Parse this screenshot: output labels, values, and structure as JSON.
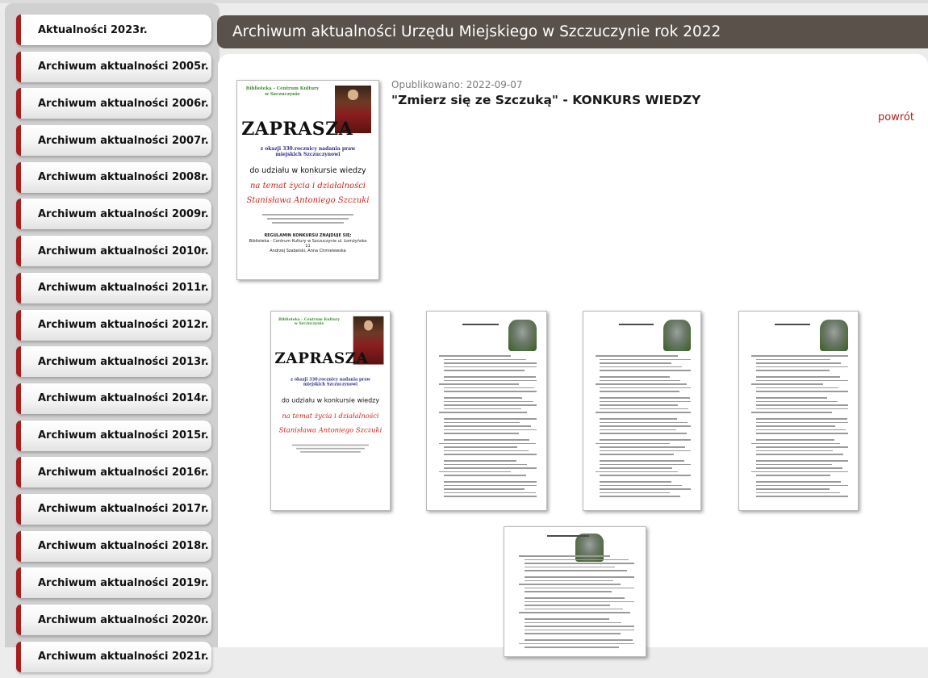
{
  "sidebar": {
    "items": [
      {
        "label": "Aktualności 2023r."
      },
      {
        "label": "Archiwum aktualności 2005r."
      },
      {
        "label": "Archiwum aktualności 2006r."
      },
      {
        "label": "Archiwum aktualności 2007r."
      },
      {
        "label": "Archiwum aktualności 2008r."
      },
      {
        "label": "Archiwum aktualności 2009r."
      },
      {
        "label": "Archiwum aktualności 2010r."
      },
      {
        "label": "Archiwum aktualności 2011r."
      },
      {
        "label": "Archiwum aktualności 2012r."
      },
      {
        "label": "Archiwum aktualności 2013r."
      },
      {
        "label": "Archiwum aktualności 2014r."
      },
      {
        "label": "Archiwum aktualności 2015r."
      },
      {
        "label": "Archiwum aktualności 2016r."
      },
      {
        "label": "Archiwum aktualności 2017r."
      },
      {
        "label": "Archiwum aktualności 2018r."
      },
      {
        "label": "Archiwum aktualności 2019r."
      },
      {
        "label": "Archiwum aktualności 2020r."
      },
      {
        "label": "Archiwum aktualności 2021r."
      }
    ]
  },
  "header": {
    "title": "Archiwum aktualności Urzędu Miejskiego w Szczuczynie rok 2022"
  },
  "article": {
    "published": "Opublikowano: 2022-09-07",
    "title": "\"Zmierz się ze Szczuką\" - KONKURS WIEDZY",
    "back_label": "powrót"
  },
  "poster": {
    "library": "Biblioteka - Centrum Kultury w Szczuczynie",
    "zaprasza": "ZAPRASZA",
    "occasion": "z okazji 330.rocznicy nadania praw miejskich Szczuczynowi",
    "invite": "do udziału w konkursie wiedzy",
    "topic": "na temat życia i działalności",
    "person": "Stanisława Antoniego Szczuki",
    "regulamin": "REGULAMIN KONKURSU ZNAJDUJE SIĘ:",
    "contact": "Biblioteka - Centrum Kultury w Szczuczynie ul. Łomżyńska 11",
    "authors": "Andrzej Szabelski, Anna Chmielewska"
  },
  "colors": {
    "header_bg": "#5a524a",
    "accent_red": "#a81d1d",
    "link_red": "#b22222",
    "sidebar_bg": "#d0d0d0"
  }
}
